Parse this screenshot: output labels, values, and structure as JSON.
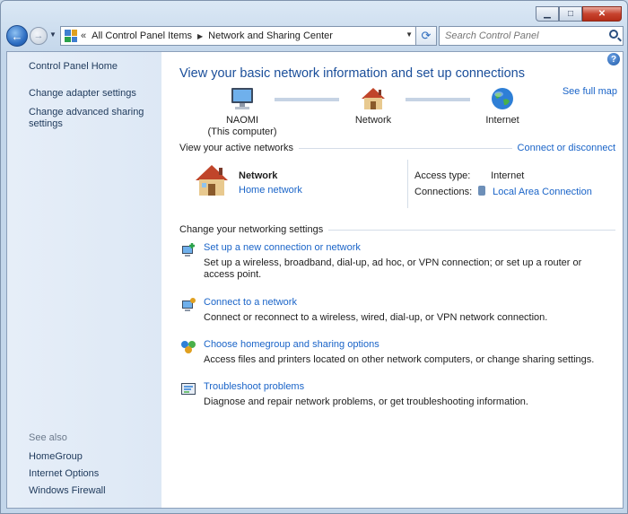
{
  "window": {
    "minimize_label": "▁",
    "maximize_label": "□",
    "close_label": "✕"
  },
  "nav": {
    "back_label": "←",
    "forward_label": "→",
    "history_dropdown": "▼"
  },
  "address": {
    "overflow": "«",
    "crumbs": [
      "All Control Panel Items",
      "Network and Sharing Center"
    ],
    "separator": "▶",
    "dropdown": "▼"
  },
  "refresh_label": "⟳",
  "search": {
    "placeholder": "Search Control Panel"
  },
  "sidebar": {
    "home": "Control Panel Home",
    "links": [
      "Change adapter settings",
      "Change advanced sharing settings"
    ],
    "see_also_heading": "See also",
    "see_also": [
      "HomeGroup",
      "Internet Options",
      "Windows Firewall"
    ]
  },
  "main": {
    "help_label": "?",
    "title": "View your basic network information and set up connections",
    "see_full_map": "See full map",
    "map": {
      "computer_name": "NAOMI",
      "computer_sub": "(This computer)",
      "network": "Network",
      "internet": "Internet"
    },
    "active_heading": "View your active networks",
    "connect_disconnect": "Connect or disconnect",
    "active_network": {
      "name": "Network",
      "type": "Home network",
      "access_type_label": "Access type:",
      "access_type_value": "Internet",
      "connections_label": "Connections:",
      "connections_value": "Local Area Connection"
    },
    "change_heading": "Change your networking settings",
    "tasks": [
      {
        "icon": "new-connection-icon",
        "title": "Set up a new connection or network",
        "desc": "Set up a wireless, broadband, dial-up, ad hoc, or VPN connection; or set up a router or access point."
      },
      {
        "icon": "connect-network-icon",
        "title": "Connect to a network",
        "desc": "Connect or reconnect to a wireless, wired, dial-up, or VPN network connection."
      },
      {
        "icon": "homegroup-icon",
        "title": "Choose homegroup and sharing options",
        "desc": "Access files and printers located on other network computers, or change sharing settings."
      },
      {
        "icon": "troubleshoot-icon",
        "title": "Troubleshoot problems",
        "desc": "Diagnose and repair network problems, or get troubleshooting information."
      }
    ]
  },
  "colors": {
    "link": "#1a64c8",
    "title": "#1a4e9a",
    "sidebar_link": "#1e395b"
  }
}
